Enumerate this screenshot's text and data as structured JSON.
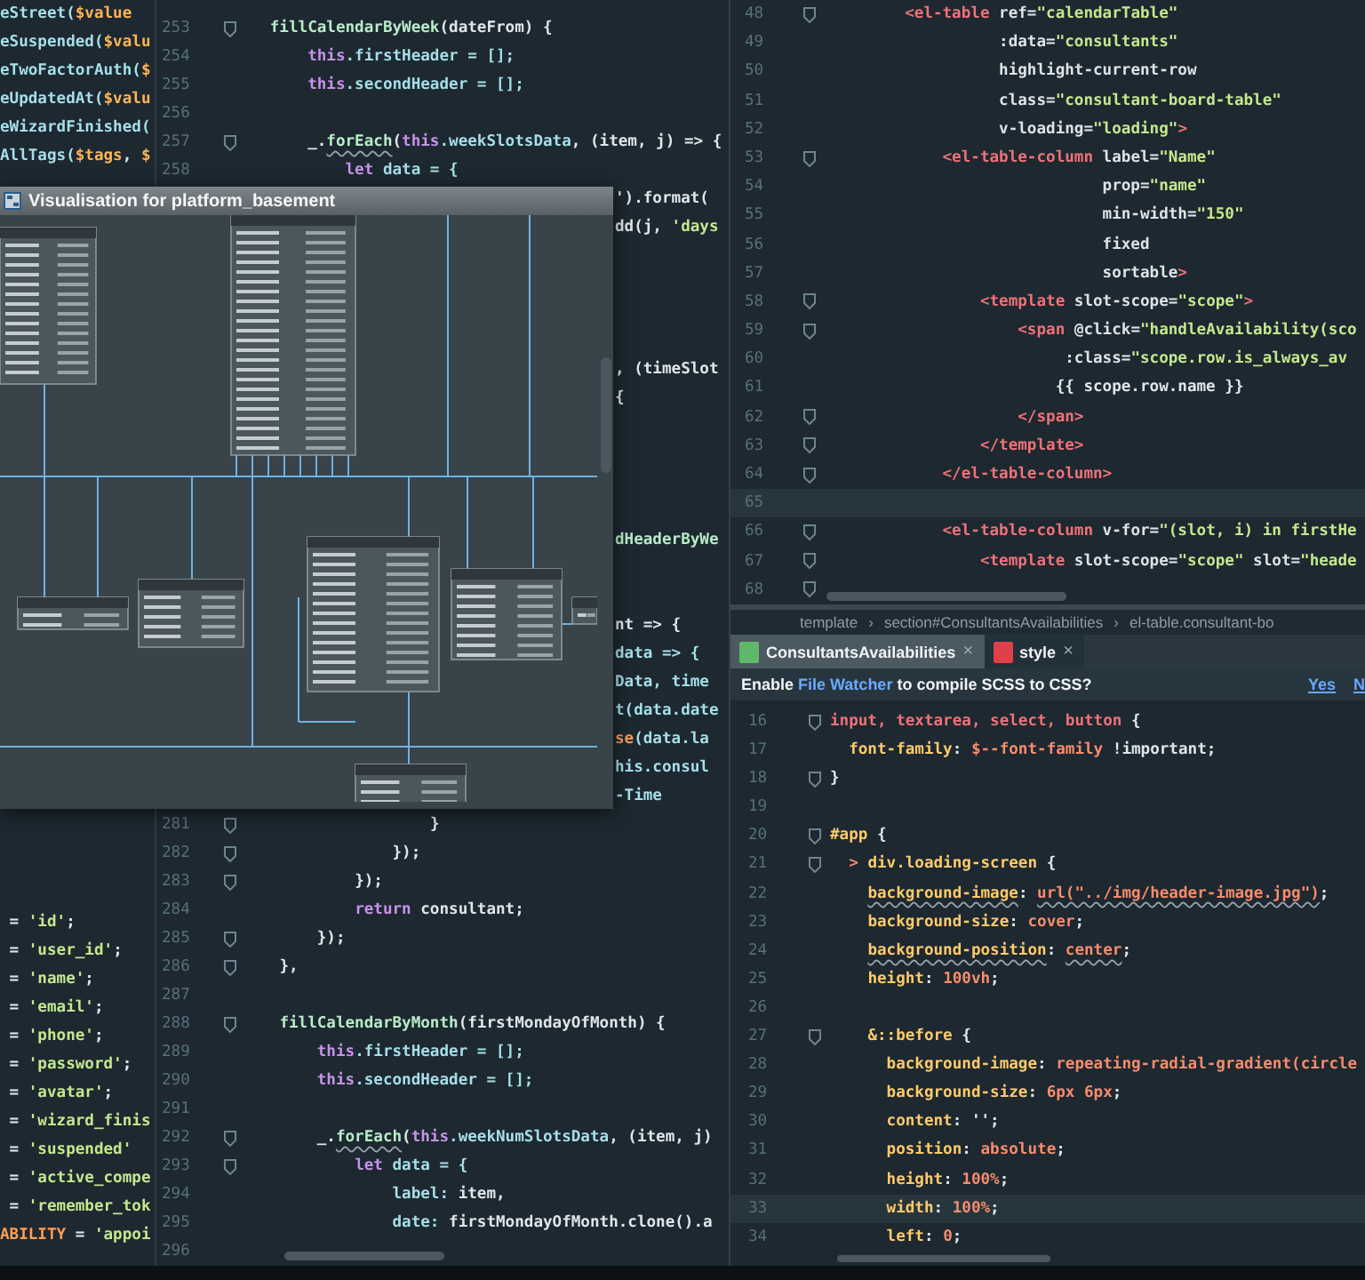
{
  "left_pane": {
    "top_lines": [
      {
        "segments": [
          {
            "text": "eStreet(",
            "kind": "property"
          },
          {
            "text": "$value",
            "kind": "variable"
          }
        ]
      },
      {
        "segments": [
          {
            "text": "eSuspended(",
            "kind": "property"
          },
          {
            "text": "$valu",
            "kind": "variable"
          }
        ]
      },
      {
        "segments": [
          {
            "text": "eTwoFactorAuth(",
            "kind": "property"
          },
          {
            "text": "$",
            "kind": "variable"
          }
        ]
      },
      {
        "segments": [
          {
            "text": "eUpdatedAt(",
            "kind": "property"
          },
          {
            "text": "$valu",
            "kind": "variable"
          }
        ]
      },
      {
        "segments": [
          {
            "text": "eWizardFinished(",
            "kind": "property"
          }
        ]
      },
      {
        "segments": [
          {
            "text": "AllTags(",
            "kind": "property"
          },
          {
            "text": "$tags",
            "kind": "variable"
          },
          {
            "text": ", ",
            "kind": "plain"
          },
          {
            "text": "$",
            "kind": "variable"
          }
        ]
      }
    ],
    "bottom_lines": [
      {
        "segments": [
          {
            "text": " = ",
            "kind": "plain"
          },
          {
            "text": "'id'",
            "kind": "string"
          },
          {
            "text": ";",
            "kind": "plain"
          }
        ]
      },
      {
        "segments": [
          {
            "text": " = ",
            "kind": "plain"
          },
          {
            "text": "'user_id'",
            "kind": "string"
          },
          {
            "text": ";",
            "kind": "plain"
          }
        ]
      },
      {
        "segments": [
          {
            "text": " = ",
            "kind": "plain"
          },
          {
            "text": "'name'",
            "kind": "string"
          },
          {
            "text": ";",
            "kind": "plain"
          }
        ]
      },
      {
        "segments": [
          {
            "text": " = ",
            "kind": "plain"
          },
          {
            "text": "'email'",
            "kind": "string"
          },
          {
            "text": ";",
            "kind": "plain"
          }
        ]
      },
      {
        "segments": [
          {
            "text": " = ",
            "kind": "plain"
          },
          {
            "text": "'phone'",
            "kind": "string"
          },
          {
            "text": ";",
            "kind": "plain"
          }
        ]
      },
      {
        "segments": [
          {
            "text": " = ",
            "kind": "plain"
          },
          {
            "text": "'password'",
            "kind": "string"
          },
          {
            "text": ";",
            "kind": "plain"
          }
        ]
      },
      {
        "segments": [
          {
            "text": " = ",
            "kind": "plain"
          },
          {
            "text": "'avatar'",
            "kind": "string"
          },
          {
            "text": ";",
            "kind": "plain"
          }
        ]
      },
      {
        "segments": [
          {
            "text": " = ",
            "kind": "plain"
          },
          {
            "text": "'wizard_finis",
            "kind": "string"
          }
        ]
      },
      {
        "segments": [
          {
            "text": " = ",
            "kind": "plain"
          },
          {
            "text": "'suspended'",
            "kind": "string"
          }
        ]
      },
      {
        "segments": [
          {
            "text": " = ",
            "kind": "plain"
          },
          {
            "text": "'active_compe",
            "kind": "string"
          }
        ]
      },
      {
        "segments": [
          {
            "text": " = ",
            "kind": "plain"
          },
          {
            "text": "'remember_tok",
            "kind": "string"
          }
        ]
      },
      {
        "segments": [
          {
            "text": "ABILITY",
            "kind": "constant"
          },
          {
            "text": " = ",
            "kind": "plain"
          },
          {
            "text": "'appoi",
            "kind": "string"
          }
        ]
      }
    ]
  },
  "middle_editor": {
    "lines": [
      {
        "kind": "numbered",
        "number": "253",
        "fold": true,
        "segments": [
          {
            "text": "   fillCalendarByWeek",
            "kind": "function"
          },
          {
            "text": "(dateFrom) {",
            "kind": "plain"
          }
        ]
      },
      {
        "kind": "numbered",
        "number": "254",
        "fold": false,
        "segments": [
          {
            "text": "       this",
            "kind": "keyword"
          },
          {
            "text": ".firstHeader = [];",
            "kind": "property"
          }
        ]
      },
      {
        "kind": "numbered",
        "number": "255",
        "fold": false,
        "segments": [
          {
            "text": "       this",
            "kind": "keyword"
          },
          {
            "text": ".secondHeader = [];",
            "kind": "property"
          }
        ]
      },
      {
        "kind": "numbered",
        "number": "256",
        "fold": false
      },
      {
        "kind": "numbered",
        "number": "257",
        "fold": true,
        "segments": [
          {
            "text": "       _.",
            "kind": "plain"
          },
          {
            "text": "forEach",
            "kind": "function",
            "squiggle": true
          },
          {
            "text": "(",
            "kind": "plain"
          },
          {
            "text": "this",
            "kind": "keyword"
          },
          {
            "text": ".weekSlotsData",
            "kind": "property"
          },
          {
            "text": ", (item, j) => {",
            "kind": "plain"
          }
        ]
      },
      {
        "kind": "numbered",
        "number": "258",
        "fold": false,
        "segments": [
          {
            "text": "           let",
            "kind": "keyword"
          },
          {
            "text": " data = {",
            "kind": "property"
          }
        ]
      },
      {
        "kind": "covered",
        "segments": [
          {
            "text": "').format(",
            "kind": "plain"
          }
        ]
      },
      {
        "kind": "covered",
        "segments": [
          {
            "text": "dd(j, ",
            "kind": "plain"
          },
          {
            "text": "'days",
            "kind": "string"
          }
        ]
      },
      {
        "kind": "hidden"
      },
      {
        "kind": "hidden"
      },
      {
        "kind": "hidden"
      },
      {
        "kind": "hidden"
      },
      {
        "kind": "covered",
        "segments": [
          {
            "text": ", (timeSlot",
            "kind": "plain"
          }
        ]
      },
      {
        "kind": "covered",
        "segments": [
          {
            "text": "{",
            "kind": "plain"
          }
        ]
      },
      {
        "kind": "hidden"
      },
      {
        "kind": "hidden"
      },
      {
        "kind": "hidden"
      },
      {
        "kind": "hidden"
      },
      {
        "kind": "covered",
        "segments": [
          {
            "text": "dHeaderByWe",
            "kind": "function"
          }
        ]
      },
      {
        "kind": "hidden"
      },
      {
        "kind": "hidden"
      },
      {
        "kind": "covered",
        "segments": [
          {
            "text": "nt => {",
            "kind": "plain"
          }
        ]
      },
      {
        "kind": "covered",
        "segments": [
          {
            "text": "data => {",
            "kind": "property"
          }
        ]
      },
      {
        "kind": "covered",
        "segments": [
          {
            "text": "Data, time",
            "kind": "property"
          }
        ]
      },
      {
        "kind": "covered",
        "segments": [
          {
            "text": "t(data.date",
            "kind": "property"
          }
        ]
      },
      {
        "kind": "covered",
        "segments": [
          {
            "text": "se",
            "kind": "constant"
          },
          {
            "text": "(data.la",
            "kind": "property"
          }
        ]
      },
      {
        "kind": "covered",
        "segments": [
          {
            "text": "his.consul",
            "kind": "property"
          }
        ]
      },
      {
        "kind": "covered",
        "segments": [
          {
            "text": "-Time",
            "kind": "property"
          }
        ]
      },
      {
        "kind": "numbered",
        "number": "281",
        "fold": true,
        "segments": [
          {
            "text": "                    }",
            "kind": "plain"
          }
        ]
      },
      {
        "kind": "numbered",
        "number": "282",
        "fold": true,
        "segments": [
          {
            "text": "                });",
            "kind": "plain"
          }
        ]
      },
      {
        "kind": "numbered",
        "number": "283",
        "fold": true,
        "segments": [
          {
            "text": "            });",
            "kind": "plain"
          }
        ]
      },
      {
        "kind": "numbered",
        "number": "284",
        "fold": false,
        "segments": [
          {
            "text": "            return",
            "kind": "keyword"
          },
          {
            "text": " consultant;",
            "kind": "plain"
          }
        ]
      },
      {
        "kind": "numbered",
        "number": "285",
        "fold": true,
        "segments": [
          {
            "text": "        });",
            "kind": "plain"
          }
        ]
      },
      {
        "kind": "numbered",
        "number": "286",
        "fold": true,
        "segments": [
          {
            "text": "    },",
            "kind": "plain"
          }
        ]
      },
      {
        "kind": "numbered",
        "number": "287",
        "fold": false
      },
      {
        "kind": "numbered",
        "number": "288",
        "fold": true,
        "segments": [
          {
            "text": "    fillCalendarByMonth",
            "kind": "function"
          },
          {
            "text": "(firstMondayOfMonth) {",
            "kind": "plain"
          }
        ]
      },
      {
        "kind": "numbered",
        "number": "289",
        "fold": false,
        "segments": [
          {
            "text": "        this",
            "kind": "keyword"
          },
          {
            "text": ".firstHeader = [];",
            "kind": "property"
          }
        ]
      },
      {
        "kind": "numbered",
        "number": "290",
        "fold": false,
        "segments": [
          {
            "text": "        this",
            "kind": "keyword"
          },
          {
            "text": ".secondHeader = [];",
            "kind": "property"
          }
        ]
      },
      {
        "kind": "numbered",
        "number": "291",
        "fold": false
      },
      {
        "kind": "numbered",
        "number": "292",
        "fold": true,
        "segments": [
          {
            "text": "        _.",
            "kind": "plain"
          },
          {
            "text": "forEach",
            "kind": "function",
            "squiggle": true
          },
          {
            "text": "(",
            "kind": "plain"
          },
          {
            "text": "this",
            "kind": "keyword"
          },
          {
            "text": ".weekNumSlotsData",
            "kind": "property"
          },
          {
            "text": ", (item, j)",
            "kind": "plain"
          }
        ]
      },
      {
        "kind": "numbered",
        "number": "293",
        "fold": true,
        "segments": [
          {
            "text": "            let",
            "kind": "keyword"
          },
          {
            "text": " data = {",
            "kind": "property"
          }
        ]
      },
      {
        "kind": "numbered",
        "number": "294",
        "fold": false,
        "segments": [
          {
            "text": "                label:",
            "kind": "property"
          },
          {
            "text": " item,",
            "kind": "plain"
          }
        ]
      },
      {
        "kind": "numbered",
        "number": "295",
        "fold": false,
        "segments": [
          {
            "text": "                date:",
            "kind": "property"
          },
          {
            "text": " firstMondayOfMonth.clone().a",
            "kind": "plain"
          }
        ]
      },
      {
        "kind": "numbered",
        "number": "296",
        "fold": false
      }
    ]
  },
  "diagram_window": {
    "title": "Visualisation for platform_basement"
  },
  "template_editor": {
    "lines": [
      {
        "number": "48",
        "fold": true,
        "current": false,
        "segments": [
          {
            "text": "       <el-table",
            "kind": "tag"
          },
          {
            "text": " ref=",
            "kind": "attribute"
          },
          {
            "text": "\"calendarTable\"",
            "kind": "string"
          }
        ]
      },
      {
        "number": "49",
        "fold": false,
        "current": false,
        "segments": [
          {
            "text": "                 :data=",
            "kind": "attribute"
          },
          {
            "text": "\"consultants\"",
            "kind": "string"
          }
        ]
      },
      {
        "number": "50",
        "fold": false,
        "current": false,
        "segments": [
          {
            "text": "                 highlight-current-row",
            "kind": "attribute"
          }
        ]
      },
      {
        "number": "51",
        "fold": false,
        "current": false,
        "segments": [
          {
            "text": "                 class=",
            "kind": "attribute"
          },
          {
            "text": "\"consultant-board-table\"",
            "kind": "string"
          }
        ]
      },
      {
        "number": "52",
        "fold": false,
        "current": false,
        "segments": [
          {
            "text": "                 v-loading=",
            "kind": "attribute"
          },
          {
            "text": "\"loading\"",
            "kind": "string"
          },
          {
            "text": ">",
            "kind": "tag"
          }
        ]
      },
      {
        "number": "53",
        "fold": true,
        "current": false,
        "segments": [
          {
            "text": "           <el-table-column",
            "kind": "tag"
          },
          {
            "text": " label=",
            "kind": "attribute"
          },
          {
            "text": "\"Name\"",
            "kind": "string"
          }
        ]
      },
      {
        "number": "54",
        "fold": false,
        "current": false,
        "segments": [
          {
            "text": "                            prop=",
            "kind": "attribute"
          },
          {
            "text": "\"name\"",
            "kind": "string"
          }
        ]
      },
      {
        "number": "55",
        "fold": false,
        "current": false,
        "segments": [
          {
            "text": "                            min-width=",
            "kind": "attribute"
          },
          {
            "text": "\"150\"",
            "kind": "string"
          }
        ]
      },
      {
        "number": "56",
        "fold": false,
        "current": false,
        "segments": [
          {
            "text": "                            fixed",
            "kind": "attribute"
          }
        ]
      },
      {
        "number": "57",
        "fold": false,
        "current": false,
        "segments": [
          {
            "text": "                            sortable",
            "kind": "attribute"
          },
          {
            "text": ">",
            "kind": "tag"
          }
        ]
      },
      {
        "number": "58",
        "fold": true,
        "current": false,
        "segments": [
          {
            "text": "               <template",
            "kind": "tag"
          },
          {
            "text": " slot-scope=",
            "kind": "attribute"
          },
          {
            "text": "\"scope\"",
            "kind": "string"
          },
          {
            "text": ">",
            "kind": "tag"
          }
        ]
      },
      {
        "number": "59",
        "fold": true,
        "current": false,
        "segments": [
          {
            "text": "                   <span",
            "kind": "tag"
          },
          {
            "text": " @click=",
            "kind": "attribute"
          },
          {
            "text": "\"handleAvailability(sco",
            "kind": "string"
          }
        ]
      },
      {
        "number": "60",
        "fold": false,
        "current": false,
        "segments": [
          {
            "text": "                        :class=",
            "kind": "attribute"
          },
          {
            "text": "\"scope.row.is_always_av",
            "kind": "string"
          }
        ]
      },
      {
        "number": "61",
        "fold": false,
        "current": false,
        "segments": [
          {
            "text": "                       {{ scope.row.name }}",
            "kind": "plain"
          }
        ]
      },
      {
        "number": "62",
        "fold": true,
        "current": false,
        "segments": [
          {
            "text": "                   </span>",
            "kind": "tag"
          }
        ]
      },
      {
        "number": "63",
        "fold": true,
        "current": false,
        "segments": [
          {
            "text": "               </template>",
            "kind": "tag"
          }
        ]
      },
      {
        "number": "64",
        "fold": true,
        "current": false,
        "segments": [
          {
            "text": "           </el-table-column>",
            "kind": "tag"
          }
        ]
      },
      {
        "number": "65",
        "fold": false,
        "current": true
      },
      {
        "number": "66",
        "fold": true,
        "current": false,
        "segments": [
          {
            "text": "           <el-table-column",
            "kind": "tag"
          },
          {
            "text": " v-for=",
            "kind": "attribute"
          },
          {
            "text": "\"(slot, i) in firstHe",
            "kind": "string"
          }
        ]
      },
      {
        "number": "67",
        "fold": true,
        "current": false,
        "segments": [
          {
            "text": "               <template",
            "kind": "tag"
          },
          {
            "text": " slot-scope=",
            "kind": "attribute"
          },
          {
            "text": "\"scope\"",
            "kind": "string"
          },
          {
            "text": " slot=",
            "kind": "attribute"
          },
          {
            "text": "\"heade",
            "kind": "string"
          }
        ]
      },
      {
        "number": "68",
        "fold": true,
        "current": false
      }
    ]
  },
  "style_editor": {
    "breadcrumbs": [
      "template",
      "section#ConsultantsAvailabilities",
      "el-table.consultant-bo"
    ],
    "separator": "›",
    "tabs": [
      {
        "label": "ConsultantsAvailabilities",
        "selected": false,
        "color": "#5fb86a",
        "close": "×"
      },
      {
        "label": "style",
        "selected": true,
        "color": "#e0404a",
        "close": "×"
      }
    ],
    "notification": {
      "before": "Enable ",
      "link": "File Watcher",
      "after": " to compile SCSS to CSS?",
      "actions": [
        "Yes",
        "N"
      ]
    },
    "lines": [
      {
        "number": "16",
        "fold": true,
        "current": false,
        "segments": [
          {
            "text": "input, textarea, select, button",
            "kind": "selector"
          },
          {
            "text": " {",
            "kind": "plain"
          }
        ]
      },
      {
        "number": "17",
        "fold": false,
        "current": false,
        "segments": [
          {
            "text": "  font-family",
            "kind": "css-property"
          },
          {
            "text": ": ",
            "kind": "plain"
          },
          {
            "text": "$--font-family",
            "kind": "css-value"
          },
          {
            "text": " !important;",
            "kind": "plain"
          }
        ]
      },
      {
        "number": "18",
        "fold": true,
        "current": false,
        "segments": [
          {
            "text": "}",
            "kind": "plain"
          }
        ]
      },
      {
        "number": "19",
        "fold": false,
        "current": false
      },
      {
        "number": "20",
        "fold": true,
        "current": false,
        "segments": [
          {
            "text": "#app",
            "kind": "css-property"
          },
          {
            "text": " {",
            "kind": "plain"
          }
        ]
      },
      {
        "number": "21",
        "fold": true,
        "current": false,
        "segments": [
          {
            "text": "  > ",
            "kind": "css-value"
          },
          {
            "text": "div.loading-screen",
            "kind": "css-property"
          },
          {
            "text": " {",
            "kind": "plain"
          }
        ]
      },
      {
        "number": "22",
        "fold": false,
        "current": false,
        "segments": [
          {
            "text": "    background-image",
            "kind": "css-property",
            "squiggle": true
          },
          {
            "text": ": ",
            "kind": "plain"
          },
          {
            "text": "url(\"../img/header-image.jpg\")",
            "kind": "css-value",
            "squiggle": true
          },
          {
            "text": ";",
            "kind": "plain"
          }
        ]
      },
      {
        "number": "23",
        "fold": false,
        "current": false,
        "segments": [
          {
            "text": "    background-size",
            "kind": "css-property"
          },
          {
            "text": ": ",
            "kind": "plain"
          },
          {
            "text": "cover",
            "kind": "css-value"
          },
          {
            "text": ";",
            "kind": "plain"
          }
        ]
      },
      {
        "number": "24",
        "fold": false,
        "current": false,
        "segments": [
          {
            "text": "    background-position",
            "kind": "css-property",
            "squiggle": true
          },
          {
            "text": ": ",
            "kind": "plain"
          },
          {
            "text": "center",
            "kind": "css-value",
            "squiggle": true
          },
          {
            "text": ";",
            "kind": "plain"
          }
        ]
      },
      {
        "number": "25",
        "fold": false,
        "current": false,
        "segments": [
          {
            "text": "    height",
            "kind": "css-property"
          },
          {
            "text": ": ",
            "kind": "plain"
          },
          {
            "text": "100vh",
            "kind": "css-value"
          },
          {
            "text": ";",
            "kind": "plain"
          }
        ]
      },
      {
        "number": "26",
        "fold": false,
        "current": false
      },
      {
        "number": "27",
        "fold": true,
        "current": false,
        "segments": [
          {
            "text": "    &::before",
            "kind": "css-property"
          },
          {
            "text": " {",
            "kind": "plain"
          }
        ]
      },
      {
        "number": "28",
        "fold": false,
        "current": false,
        "segments": [
          {
            "text": "      background-image",
            "kind": "css-property"
          },
          {
            "text": ": ",
            "kind": "plain"
          },
          {
            "text": "repeating-radial-gradient(circle",
            "kind": "css-value"
          }
        ]
      },
      {
        "number": "29",
        "fold": false,
        "current": false,
        "segments": [
          {
            "text": "      background-size",
            "kind": "css-property"
          },
          {
            "text": ": ",
            "kind": "plain"
          },
          {
            "text": "6px 6px",
            "kind": "css-value"
          },
          {
            "text": ";",
            "kind": "plain"
          }
        ]
      },
      {
        "number": "30",
        "fold": false,
        "current": false,
        "segments": [
          {
            "text": "      content",
            "kind": "css-property"
          },
          {
            "text": ": '';",
            "kind": "plain"
          }
        ]
      },
      {
        "number": "31",
        "fold": false,
        "current": false,
        "segments": [
          {
            "text": "      position",
            "kind": "css-property"
          },
          {
            "text": ": ",
            "kind": "plain"
          },
          {
            "text": "absolute",
            "kind": "css-value"
          },
          {
            "text": ";",
            "kind": "plain"
          }
        ]
      },
      {
        "number": "32",
        "fold": false,
        "current": false,
        "segments": [
          {
            "text": "      height",
            "kind": "css-property"
          },
          {
            "text": ": ",
            "kind": "plain"
          },
          {
            "text": "100%",
            "kind": "css-value"
          },
          {
            "text": ";",
            "kind": "plain"
          }
        ]
      },
      {
        "number": "33",
        "fold": false,
        "current": true,
        "segments": [
          {
            "text": "      width",
            "kind": "css-property"
          },
          {
            "text": ": ",
            "kind": "plain"
          },
          {
            "text": "100%",
            "kind": "css-value"
          },
          {
            "text": ";",
            "kind": "plain"
          }
        ]
      },
      {
        "number": "34",
        "fold": false,
        "current": false,
        "segments": [
          {
            "text": "      left",
            "kind": "css-property"
          },
          {
            "text": ": ",
            "kind": "plain"
          },
          {
            "text": "0",
            "kind": "css-value"
          },
          {
            "text": ";",
            "kind": "plain"
          }
        ]
      }
    ]
  }
}
